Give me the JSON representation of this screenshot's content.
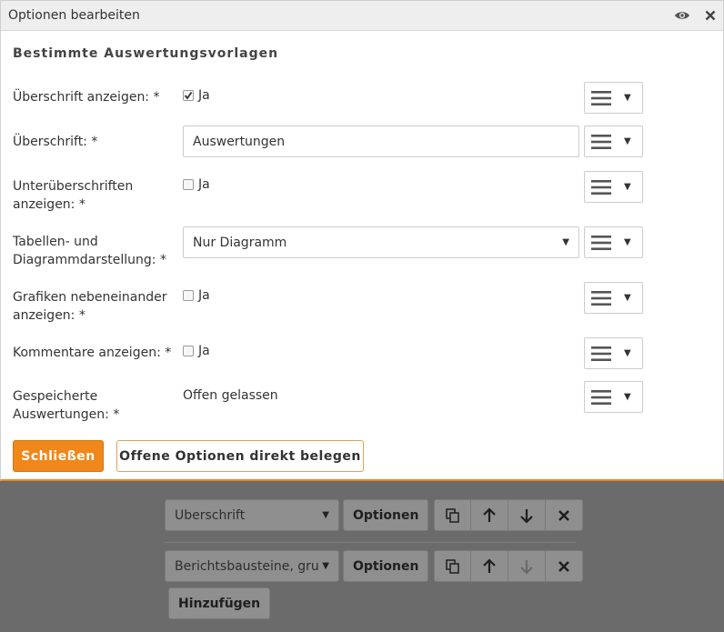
{
  "dialog": {
    "title": "Optionen bearbeiten",
    "section_title": "Bestimmte Auswertungsvorlagen",
    "fields": [
      {
        "label_line1": "Überschrift anzeigen: *",
        "label_line2": "",
        "type": "checkbox",
        "checked": true,
        "value": "Ja"
      },
      {
        "label_line1": "Überschrift: *",
        "label_line2": "",
        "type": "text",
        "value": "Auswertungen"
      },
      {
        "label_line1": "Unterüberschriften",
        "label_line2": "anzeigen: *",
        "type": "checkbox",
        "checked": false,
        "value": "Ja"
      },
      {
        "label_line1": "Tabellen- und",
        "label_line2": "Diagrammdarstellung: *",
        "type": "select",
        "value": "Nur Diagramm"
      },
      {
        "label_line1": "Grafiken nebeneinander",
        "label_line2": "anzeigen: *",
        "type": "checkbox",
        "checked": false,
        "value": "Ja"
      },
      {
        "label_line1": "Kommentare anzeigen: *",
        "label_line2": "",
        "type": "checkbox",
        "checked": false,
        "value": "Ja"
      },
      {
        "label_line1": "Gespeicherte",
        "label_line2": "Auswertungen: *",
        "type": "static",
        "value": "Offen gelassen"
      }
    ],
    "close_label": "Schließen",
    "fill_label": "Offene Optionen direkt belegen"
  },
  "background": {
    "row1_select": "Überschrift",
    "row2_select": "Berichtsbausteine, grupp",
    "options_label": "Optionen",
    "add_label": "Hinzufügen"
  },
  "colors": {
    "accent": "#f0871a",
    "overlay": "#6b6b6b"
  },
  "icons": [
    "eye-icon",
    "close-icon",
    "hamburger-icon",
    "copy-icon",
    "arrow-up-icon",
    "arrow-down-icon",
    "delete-icon"
  ]
}
